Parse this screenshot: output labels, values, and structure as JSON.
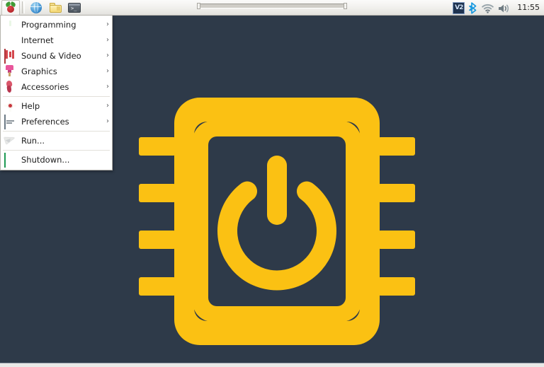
{
  "desktop": {
    "background_color": "#2e3a49",
    "logo": {
      "name": "chip-power-logo",
      "accent_color": "#fbc113",
      "description": "CPU chip outline with power symbol"
    }
  },
  "taskbar": {
    "background_color": "#f0efec",
    "launchers": [
      {
        "name": "menu-raspberry",
        "label": "Menu",
        "icon": "raspberry-icon"
      },
      {
        "name": "web-browser",
        "label": "Web Browser",
        "icon": "globe-icon"
      },
      {
        "name": "file-manager",
        "label": "File Manager",
        "icon": "folder-icon"
      },
      {
        "name": "terminal",
        "label": "Terminal",
        "icon": "terminal-icon"
      }
    ],
    "tray": [
      {
        "name": "vnc",
        "label": "V2",
        "icon": "vnc-icon"
      },
      {
        "name": "bluetooth",
        "label": "Bluetooth",
        "icon": "bluetooth-icon"
      },
      {
        "name": "wifi",
        "label": "Wireless",
        "icon": "wifi-icon"
      },
      {
        "name": "volume",
        "label": "Volume",
        "icon": "volume-icon"
      }
    ],
    "clock": "11:55"
  },
  "menu": {
    "arrow_glyph": "›",
    "items": [
      {
        "label": "Programming",
        "icon": "programming-icon",
        "has_submenu": true,
        "separator_after": false
      },
      {
        "label": "Internet",
        "icon": "internet-icon",
        "has_submenu": true,
        "separator_after": false
      },
      {
        "label": "Sound & Video",
        "icon": "sound-video-icon",
        "has_submenu": true,
        "separator_after": false
      },
      {
        "label": "Graphics",
        "icon": "graphics-icon",
        "has_submenu": true,
        "separator_after": false
      },
      {
        "label": "Accessories",
        "icon": "accessories-icon",
        "has_submenu": true,
        "separator_after": true
      },
      {
        "label": "Help",
        "icon": "help-icon",
        "has_submenu": true,
        "separator_after": false
      },
      {
        "label": "Preferences",
        "icon": "preferences-icon",
        "has_submenu": true,
        "separator_after": true
      },
      {
        "label": "Run...",
        "icon": "run-icon",
        "has_submenu": false,
        "separator_after": true
      },
      {
        "label": "Shutdown...",
        "icon": "shutdown-icon",
        "has_submenu": false,
        "separator_after": false
      }
    ]
  }
}
